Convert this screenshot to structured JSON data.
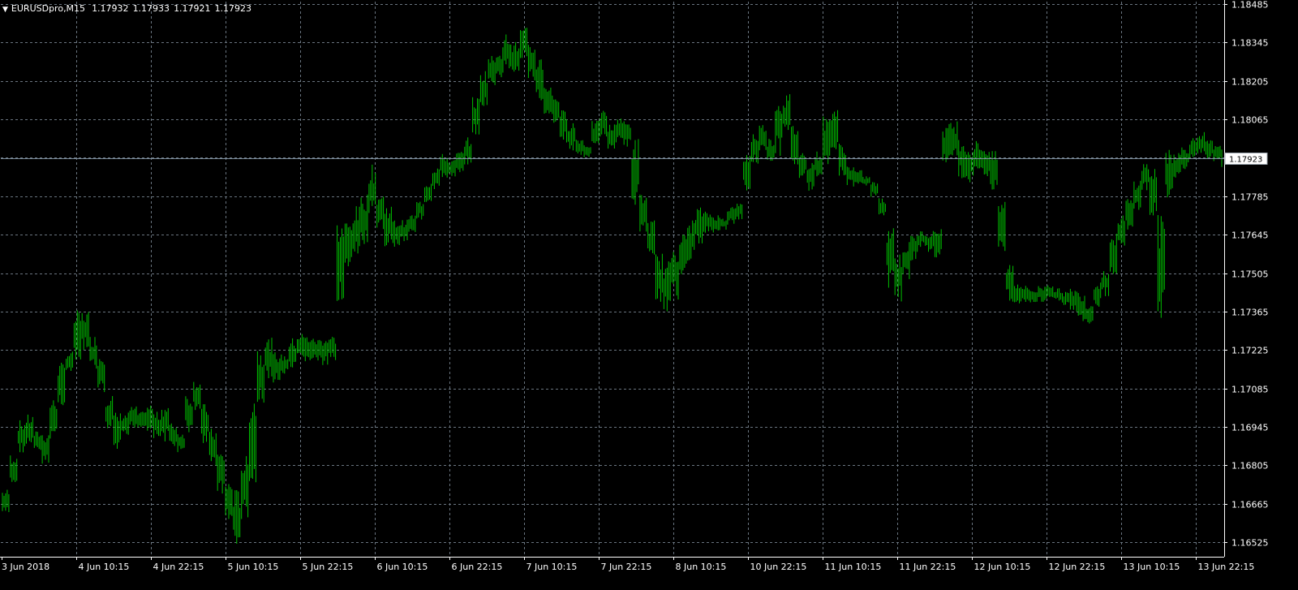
{
  "header": {
    "symbol": "EURUSDpro,M15",
    "open": "1.17932",
    "high": "1.17933",
    "low": "1.17921",
    "close": "1.17923",
    "marker_icon": "triangle-down-icon"
  },
  "colors": {
    "background": "#000000",
    "bars": "#00c000",
    "grid": "#6a7580",
    "axis": "#ffffff",
    "price_line": "#7b8c9c"
  },
  "current_price_label": "1.17923",
  "chart_data": {
    "type": "bar",
    "timeframe": "M15",
    "grid": true,
    "y_ticks": [
      "1.18485",
      "1.18345",
      "1.18205",
      "1.18065",
      "1.17925",
      "1.17785",
      "1.17645",
      "1.17505",
      "1.17365",
      "1.17225",
      "1.17085",
      "1.16945",
      "1.16805",
      "1.16665",
      "1.16525"
    ],
    "ylim": [
      1.1648,
      1.1849
    ],
    "x_ticks": [
      "3 Jun 2018",
      "4 Jun 10:15",
      "4 Jun 22:15",
      "5 Jun 10:15",
      "5 Jun 22:15",
      "6 Jun 10:15",
      "6 Jun 22:15",
      "7 Jun 10:15",
      "7 Jun 22:15",
      "8 Jun 10:15",
      "10 Jun 22:15",
      "11 Jun 10:15",
      "11 Jun 22:15",
      "12 Jun 10:15",
      "12 Jun 22:15",
      "13 Jun 10:15",
      "13 Jun 22:15"
    ],
    "current_price": 1.17923,
    "series": [
      {
        "values": [
          [
            1.1662,
            1.1672
          ],
          [
            1.1673,
            1.1685
          ],
          [
            1.1685,
            1.1697
          ],
          [
            1.1687,
            1.1699
          ],
          [
            1.1685,
            1.1693
          ],
          [
            1.168,
            1.1693
          ],
          [
            1.169,
            1.1705
          ],
          [
            1.1702,
            1.1718
          ],
          [
            1.1714,
            1.1722
          ],
          [
            1.1716,
            1.1737
          ],
          [
            1.1722,
            1.1737
          ],
          [
            1.1715,
            1.1728
          ],
          [
            1.1706,
            1.1722
          ],
          [
            1.1692,
            1.1707
          ],
          [
            1.1685,
            1.17
          ],
          [
            1.169,
            1.17
          ],
          [
            1.1694,
            1.1702
          ],
          [
            1.1694,
            1.17
          ],
          [
            1.1693,
            1.1703
          ],
          [
            1.169,
            1.17
          ],
          [
            1.1689,
            1.1703
          ],
          [
            1.1687,
            1.1696
          ],
          [
            1.1685,
            1.1693
          ],
          [
            1.1692,
            1.1707
          ],
          [
            1.17,
            1.1712
          ],
          [
            1.1688,
            1.1703
          ],
          [
            1.168,
            1.1694
          ],
          [
            1.167,
            1.1686
          ],
          [
            1.166,
            1.1675
          ],
          [
            1.165,
            1.1672
          ],
          [
            1.166,
            1.1684
          ],
          [
            1.1668,
            1.171
          ],
          [
            1.17,
            1.1725
          ],
          [
            1.1712,
            1.1727
          ],
          [
            1.171,
            1.1722
          ],
          [
            1.1713,
            1.1721
          ],
          [
            1.1714,
            1.1727
          ],
          [
            1.1718,
            1.1729
          ],
          [
            1.1718,
            1.1728
          ],
          [
            1.1718,
            1.1727
          ],
          [
            1.1716,
            1.1728
          ],
          [
            1.1718,
            1.1728
          ],
          [
            1.174,
            1.177
          ],
          [
            1.175,
            1.177
          ],
          [
            1.1755,
            1.1775
          ],
          [
            1.176,
            1.178
          ],
          [
            1.177,
            1.179
          ],
          [
            1.1765,
            1.178
          ],
          [
            1.176,
            1.1776
          ],
          [
            1.176,
            1.177
          ],
          [
            1.1762,
            1.177
          ],
          [
            1.1765,
            1.1772
          ],
          [
            1.177,
            1.1777
          ],
          [
            1.1774,
            1.1785
          ],
          [
            1.178,
            1.179
          ],
          [
            1.1785,
            1.1794
          ],
          [
            1.1785,
            1.1792
          ],
          [
            1.1787,
            1.1795
          ],
          [
            1.179,
            1.18
          ],
          [
            1.18,
            1.1815
          ],
          [
            1.181,
            1.1825
          ],
          [
            1.1818,
            1.183
          ],
          [
            1.182,
            1.1833
          ],
          [
            1.1825,
            1.1838
          ],
          [
            1.1822,
            1.1835
          ],
          [
            1.1828,
            1.184
          ],
          [
            1.182,
            1.1834
          ],
          [
            1.1812,
            1.183
          ],
          [
            1.1808,
            1.182
          ],
          [
            1.1805,
            1.1816
          ],
          [
            1.1798,
            1.181
          ],
          [
            1.1795,
            1.1806
          ],
          [
            1.1793,
            1.18
          ],
          [
            1.1792,
            1.1798
          ],
          [
            1.1796,
            1.1806
          ],
          [
            1.18,
            1.181
          ],
          [
            1.1794,
            1.1805
          ],
          [
            1.1798,
            1.1808
          ],
          [
            1.1796,
            1.1806
          ],
          [
            1.1775,
            1.18
          ],
          [
            1.1765,
            1.178
          ],
          [
            1.1755,
            1.177
          ],
          [
            1.174,
            1.1758
          ],
          [
            1.1735,
            1.1755
          ],
          [
            1.174,
            1.1762
          ],
          [
            1.175,
            1.1765
          ],
          [
            1.1755,
            1.177
          ],
          [
            1.176,
            1.1775
          ],
          [
            1.1765,
            1.1773
          ],
          [
            1.1765,
            1.1772
          ],
          [
            1.1766,
            1.1771
          ],
          [
            1.1768,
            1.1775
          ],
          [
            1.177,
            1.1776
          ],
          [
            1.178,
            1.1795
          ],
          [
            1.179,
            1.1802
          ],
          [
            1.1795,
            1.1805
          ],
          [
            1.179,
            1.18
          ],
          [
            1.1793,
            1.1815
          ],
          [
            1.18,
            1.1816
          ],
          [
            1.179,
            1.1805
          ],
          [
            1.1785,
            1.1795
          ],
          [
            1.178,
            1.1792
          ],
          [
            1.1785,
            1.1795
          ],
          [
            1.179,
            1.1808
          ],
          [
            1.1795,
            1.1812
          ],
          [
            1.1785,
            1.1798
          ],
          [
            1.1782,
            1.179
          ],
          [
            1.1783,
            1.1788
          ],
          [
            1.1782,
            1.1786
          ],
          [
            1.1778,
            1.1784
          ],
          [
            1.177,
            1.1778
          ],
          [
            1.1745,
            1.177
          ],
          [
            1.174,
            1.1758
          ],
          [
            1.1748,
            1.1762
          ],
          [
            1.1755,
            1.1765
          ],
          [
            1.176,
            1.1766
          ],
          [
            1.1758,
            1.1766
          ],
          [
            1.1755,
            1.1768
          ],
          [
            1.179,
            1.1805
          ],
          [
            1.179,
            1.1807
          ],
          [
            1.1785,
            1.18
          ],
          [
            1.1783,
            1.1797
          ],
          [
            1.1786,
            1.1799
          ],
          [
            1.1785,
            1.1797
          ],
          [
            1.178,
            1.1795
          ],
          [
            1.1755,
            1.1778
          ],
          [
            1.174,
            1.1755
          ],
          [
            1.1738,
            1.1748
          ],
          [
            1.174,
            1.1746
          ],
          [
            1.1739,
            1.1745
          ],
          [
            1.174,
            1.1746
          ],
          [
            1.1741,
            1.1747
          ],
          [
            1.174,
            1.1745
          ],
          [
            1.1738,
            1.1744
          ],
          [
            1.1736,
            1.1745
          ],
          [
            1.1733,
            1.1744
          ],
          [
            1.1731,
            1.174
          ],
          [
            1.1738,
            1.1748
          ],
          [
            1.1742,
            1.1752
          ],
          [
            1.175,
            1.1765
          ],
          [
            1.176,
            1.1772
          ],
          [
            1.1766,
            1.1778
          ],
          [
            1.1773,
            1.1785
          ],
          [
            1.178,
            1.1791
          ],
          [
            1.177,
            1.179
          ],
          [
            1.1733,
            1.1772
          ],
          [
            1.1775,
            1.1798
          ],
          [
            1.1785,
            1.1795
          ],
          [
            1.1788,
            1.1797
          ],
          [
            1.1792,
            1.18
          ],
          [
            1.1794,
            1.1802
          ],
          [
            1.1792,
            1.1799
          ],
          [
            1.1791,
            1.1797
          ],
          [
            1.1789,
            1.1796
          ]
        ]
      }
    ]
  }
}
